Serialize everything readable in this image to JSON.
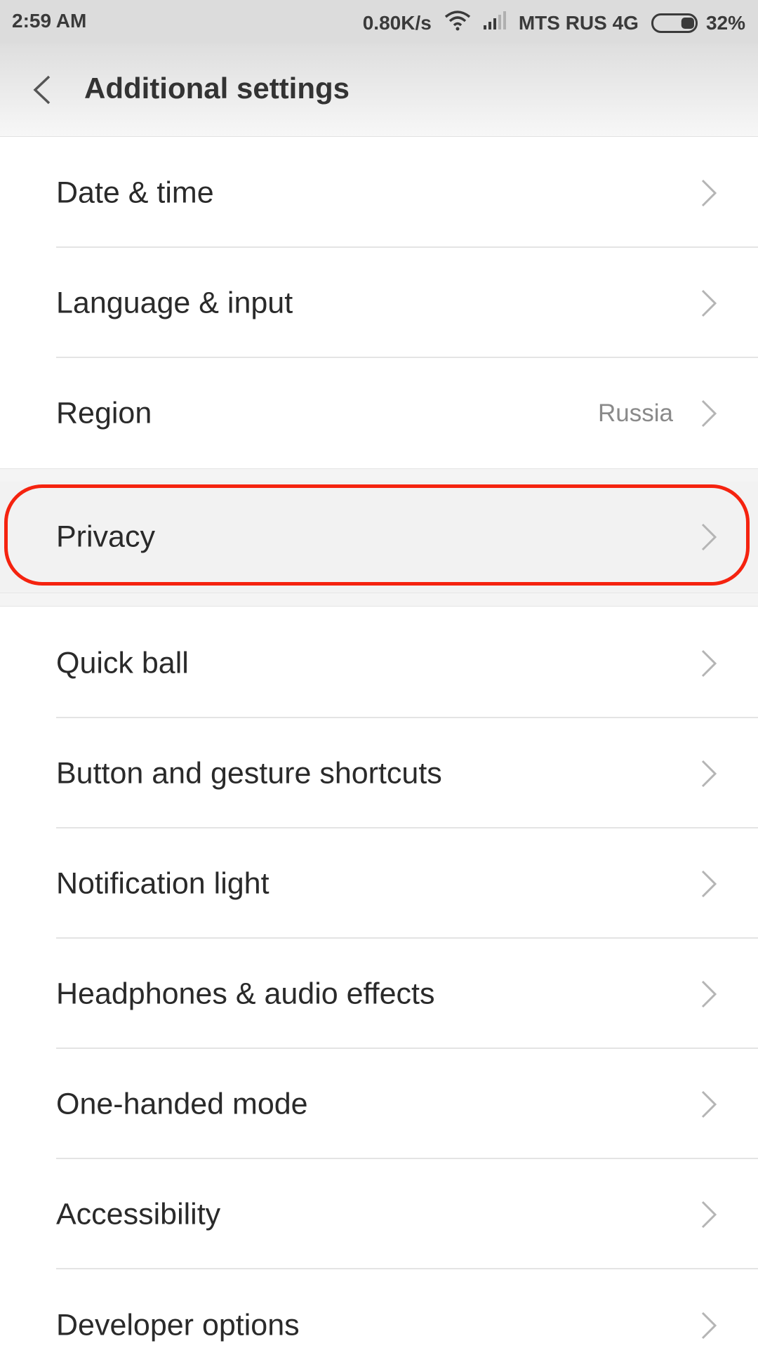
{
  "status_bar": {
    "time": "2:59 AM",
    "net_speed": "0.80K/s",
    "carrier": "MTS RUS 4G",
    "battery": "32%",
    "battery_level": 0.32
  },
  "header": {
    "title": "Additional settings",
    "back_icon": "chevron-left-icon"
  },
  "settings": {
    "items": [
      {
        "label": "Date & time"
      },
      {
        "label": "Language & input"
      },
      {
        "label": "Region",
        "value": "Russia"
      },
      {
        "label": "Privacy",
        "highlighted": true
      },
      {
        "label": "Quick ball"
      },
      {
        "label": "Button and gesture shortcuts"
      },
      {
        "label": "Notification light"
      },
      {
        "label": "Headphones & audio effects"
      },
      {
        "label": "One-handed mode"
      },
      {
        "label": "Accessibility"
      },
      {
        "label": "Developer options"
      }
    ]
  },
  "colors": {
    "highlight": "#f5230f",
    "chevron": "#b5b5b5"
  }
}
